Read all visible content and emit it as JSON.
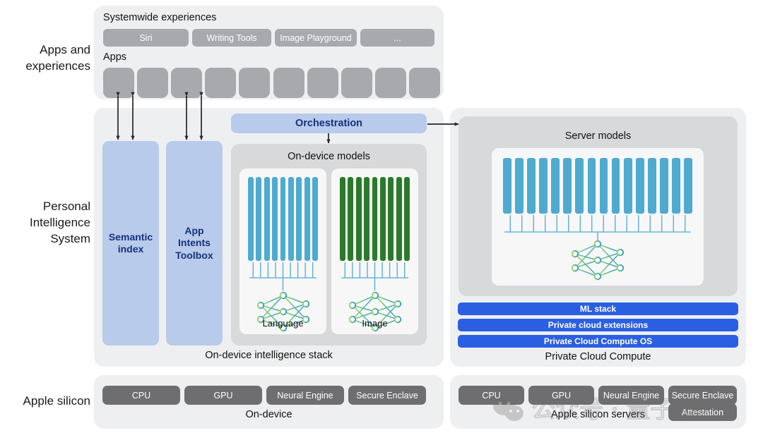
{
  "rows": [
    {
      "label": "Apps and\nexperiences"
    },
    {
      "label": "Personal\nIntelligence\nSystem"
    },
    {
      "label": "Apple silicon"
    }
  ],
  "apps_panel": {
    "systemwide_title": "Systemwide experiences",
    "systemwide_items": [
      "Siri",
      "Writing Tools",
      "Image Playground",
      "..."
    ],
    "apps_title": "Apps",
    "app_count": 10
  },
  "pis_panel": {
    "caption": "On-device intelligence stack",
    "columns": [
      {
        "label": "Semantic\nindex"
      },
      {
        "label": "App\nIntents\nToolbox"
      }
    ],
    "orchestration_label": "Orchestration",
    "ondevice_models_title": "On-device models",
    "models": [
      {
        "caption": "Language",
        "bar_count": 9,
        "color": "#4faad0"
      },
      {
        "caption": "Image",
        "bar_count": 9,
        "color": "#2b7a2b"
      }
    ]
  },
  "pcc_panel": {
    "caption": "Private Cloud Compute",
    "server_models_title": "Server models",
    "server_bar_count": 16,
    "server_bar_color": "#4faad0",
    "stack_bars": [
      "ML stack",
      "Private cloud extensions",
      "Private Cloud Compute OS"
    ]
  },
  "silicon_left": {
    "pills": [
      "CPU",
      "GPU",
      "Neural Engine",
      "Secure Enclave"
    ],
    "caption": "On-device"
  },
  "silicon_right": {
    "pills": [
      "CPU",
      "GPU",
      "Neural Engine",
      "Secure Enclave"
    ],
    "extra_pill": "Attestation",
    "caption": "Apple silicon servers"
  },
  "watermark": {
    "text": "公众号 · 量子位"
  },
  "colors": {
    "panel_bg": "#eeeff1",
    "panel_inner": "#d8d9db",
    "blue_column": "#b9cbea",
    "blue_text": "#14307e",
    "ml_blue": "#2b5fe3",
    "grey_pill": "#a8a9ad",
    "silicon_pill": "#6e6e70",
    "bar_blue": "#4faad0",
    "bar_green": "#2b7a2b"
  }
}
